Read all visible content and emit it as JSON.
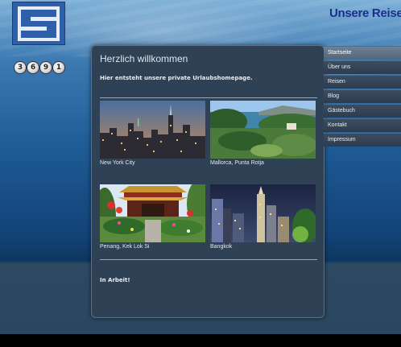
{
  "header": {
    "site_title": "Unsere Reisen",
    "logo_text": "S5"
  },
  "counter": {
    "digits": [
      "3",
      "6",
      "9",
      "1"
    ]
  },
  "main": {
    "welcome_title": "Herzlich willkommen",
    "subtitle": "Hier entsteht unsere private Urlaubshomepage.",
    "tiles": [
      {
        "caption": "New York City"
      },
      {
        "caption": "Mallorca, Punta Rotja"
      },
      {
        "caption": "Penang, Kek Lok Si"
      },
      {
        "caption": "Bangkok"
      }
    ],
    "footer_note": "In Arbeit!"
  },
  "nav": {
    "items": [
      {
        "label": "Startseite"
      },
      {
        "label": "Über uns"
      },
      {
        "label": "Reisen"
      },
      {
        "label": "Blog"
      },
      {
        "label": "Gästebuch"
      },
      {
        "label": "Kontakt"
      },
      {
        "label": "Impressum"
      }
    ]
  },
  "colors": {
    "panel": "#2f4154",
    "nav_active": "#5f7388",
    "title_blue": "#1a2f8a"
  }
}
